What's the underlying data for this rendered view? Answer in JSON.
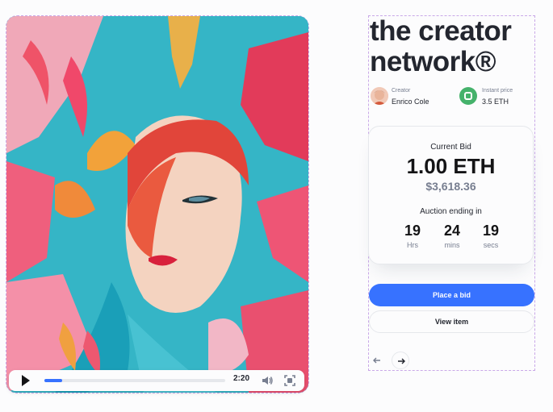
{
  "item": {
    "title": "the creator network®"
  },
  "creator": {
    "label": "Creator",
    "name": "Enrico Cole"
  },
  "price": {
    "label": "Instant price",
    "value": "3.5 ETH"
  },
  "bid": {
    "label": "Current Bid",
    "eth": "1.00 ETH",
    "usd": "$3,618.36"
  },
  "auction": {
    "label": "Auction ending in",
    "hours": "19",
    "hours_unit": "Hrs",
    "mins": "24",
    "mins_unit": "mins",
    "secs": "19",
    "secs_unit": "secs"
  },
  "actions": {
    "place_bid": "Place a bid",
    "view_item": "View item"
  },
  "player": {
    "time": "2:20",
    "progress_fraction": 0.1
  },
  "colors": {
    "accent": "#3772ff",
    "price_green": "#45b26b"
  },
  "icons": {
    "play": "play-icon",
    "volume": "volume-icon",
    "fullscreen": "fullscreen-icon",
    "prev": "arrow-left-icon",
    "next": "arrow-right-icon"
  }
}
